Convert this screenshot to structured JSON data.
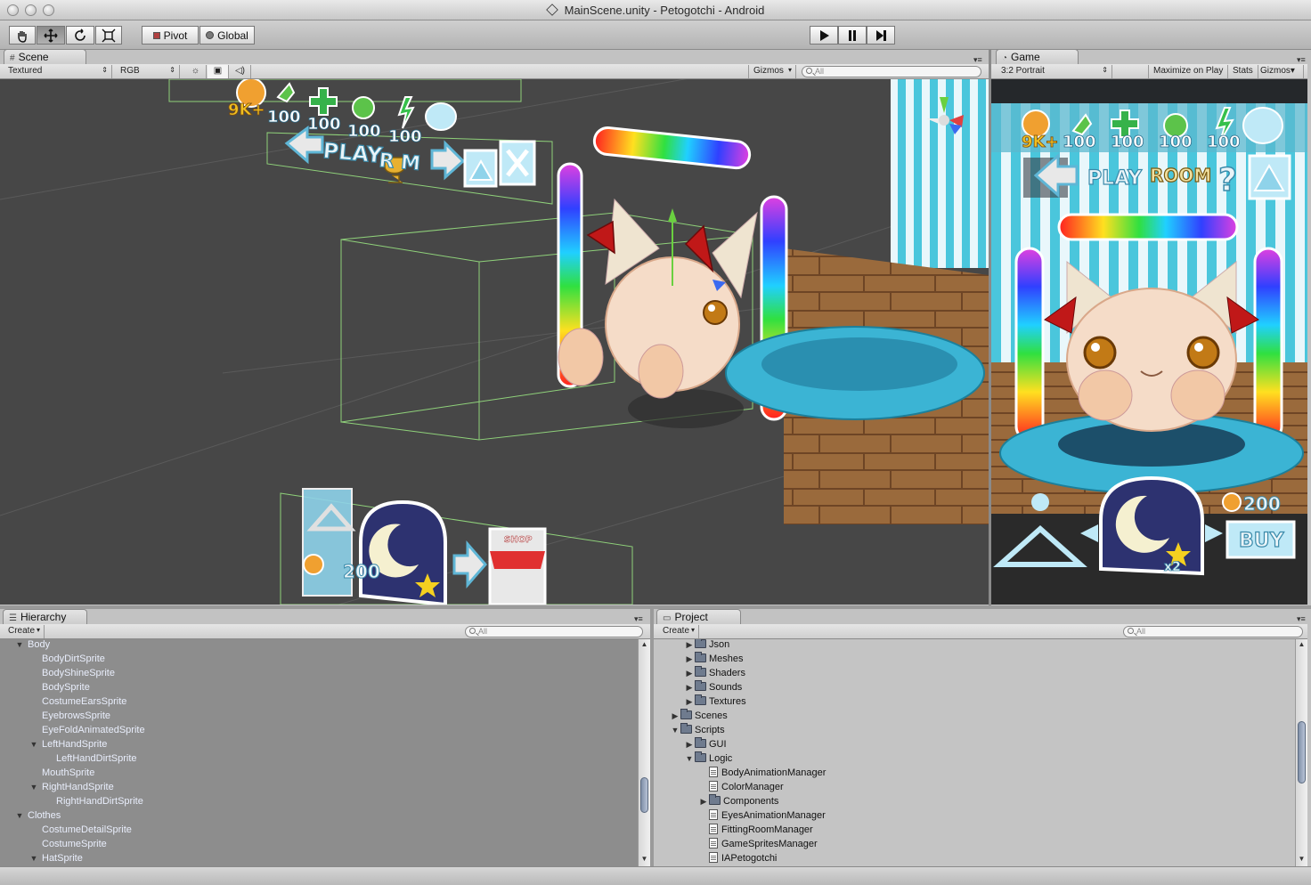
{
  "window": {
    "title": "MainScene.unity - Petogotchi - Android"
  },
  "toolbar": {
    "pivot_label": "Pivot",
    "global_label": "Global"
  },
  "scene": {
    "tab_label": "Scene",
    "render_mode": "Textured",
    "color_mode": "RGB",
    "gizmos_label": "Gizmos",
    "search_placeholder": "All",
    "hud_numbers": [
      "9K+",
      "100",
      "100",
      "100",
      "100"
    ],
    "menu_labels": {
      "play": "PLAY",
      "room": "R M",
      "price": "200",
      "shop": "SHOP"
    }
  },
  "game": {
    "tab_label": "Game",
    "aspect": "3:2 Portrait",
    "maximize_label": "Maximize on Play",
    "stats_label": "Stats",
    "gizmos_label": "Gizmos",
    "hud_numbers": [
      "9K+",
      "100",
      "100",
      "100",
      "100"
    ],
    "menu_labels": {
      "play": "PLAY",
      "room": "ROOM",
      "question": "?",
      "price": "200",
      "buy": "BUY",
      "multiplier": "x2"
    }
  },
  "hierarchy": {
    "tab_label": "Hierarchy",
    "create_label": "Create",
    "search_placeholder": "All",
    "items": [
      {
        "label": "Body",
        "depth": 0,
        "expanded": true
      },
      {
        "label": "BodyDirtSprite",
        "depth": 1
      },
      {
        "label": "BodyShineSprite",
        "depth": 1
      },
      {
        "label": "BodySprite",
        "depth": 1
      },
      {
        "label": "CostumeEarsSprite",
        "depth": 1
      },
      {
        "label": "EyebrowsSprite",
        "depth": 1
      },
      {
        "label": "EyeFoldAnimatedSprite",
        "depth": 1
      },
      {
        "label": "LeftHandSprite",
        "depth": 1,
        "expanded": true
      },
      {
        "label": "LeftHandDirtSprite",
        "depth": 2
      },
      {
        "label": "MouthSprite",
        "depth": 1
      },
      {
        "label": "RightHandSprite",
        "depth": 1,
        "expanded": true
      },
      {
        "label": "RightHandDirtSprite",
        "depth": 2
      },
      {
        "label": "Clothes",
        "depth": 0,
        "expanded": true
      },
      {
        "label": "CostumeDetailSprite",
        "depth": 1
      },
      {
        "label": "CostumeSprite",
        "depth": 1
      },
      {
        "label": "HatSprite",
        "depth": 1,
        "expanded": true
      }
    ]
  },
  "project": {
    "tab_label": "Project",
    "create_label": "Create",
    "search_placeholder": "All",
    "items": [
      {
        "label": "Json",
        "depth": 1,
        "type": "folder",
        "expanded": false
      },
      {
        "label": "Meshes",
        "depth": 1,
        "type": "folder",
        "expanded": false
      },
      {
        "label": "Shaders",
        "depth": 1,
        "type": "folder",
        "expanded": false
      },
      {
        "label": "Sounds",
        "depth": 1,
        "type": "folder",
        "expanded": false
      },
      {
        "label": "Textures",
        "depth": 1,
        "type": "folder",
        "expanded": false
      },
      {
        "label": "Scenes",
        "depth": 0,
        "type": "folder",
        "expanded": false
      },
      {
        "label": "Scripts",
        "depth": 0,
        "type": "folder",
        "expanded": true
      },
      {
        "label": "GUI",
        "depth": 1,
        "type": "folder",
        "expanded": false
      },
      {
        "label": "Logic",
        "depth": 1,
        "type": "folder",
        "expanded": true
      },
      {
        "label": "BodyAnimationManager",
        "depth": 2,
        "type": "file"
      },
      {
        "label": "ColorManager",
        "depth": 2,
        "type": "file"
      },
      {
        "label": "Components",
        "depth": 2,
        "type": "folder",
        "expanded": false
      },
      {
        "label": "EyesAnimationManager",
        "depth": 2,
        "type": "file"
      },
      {
        "label": "FittingRoomManager",
        "depth": 2,
        "type": "file"
      },
      {
        "label": "GameSpritesManager",
        "depth": 2,
        "type": "file"
      },
      {
        "label": "IAPetogotchi",
        "depth": 2,
        "type": "file"
      }
    ]
  }
}
